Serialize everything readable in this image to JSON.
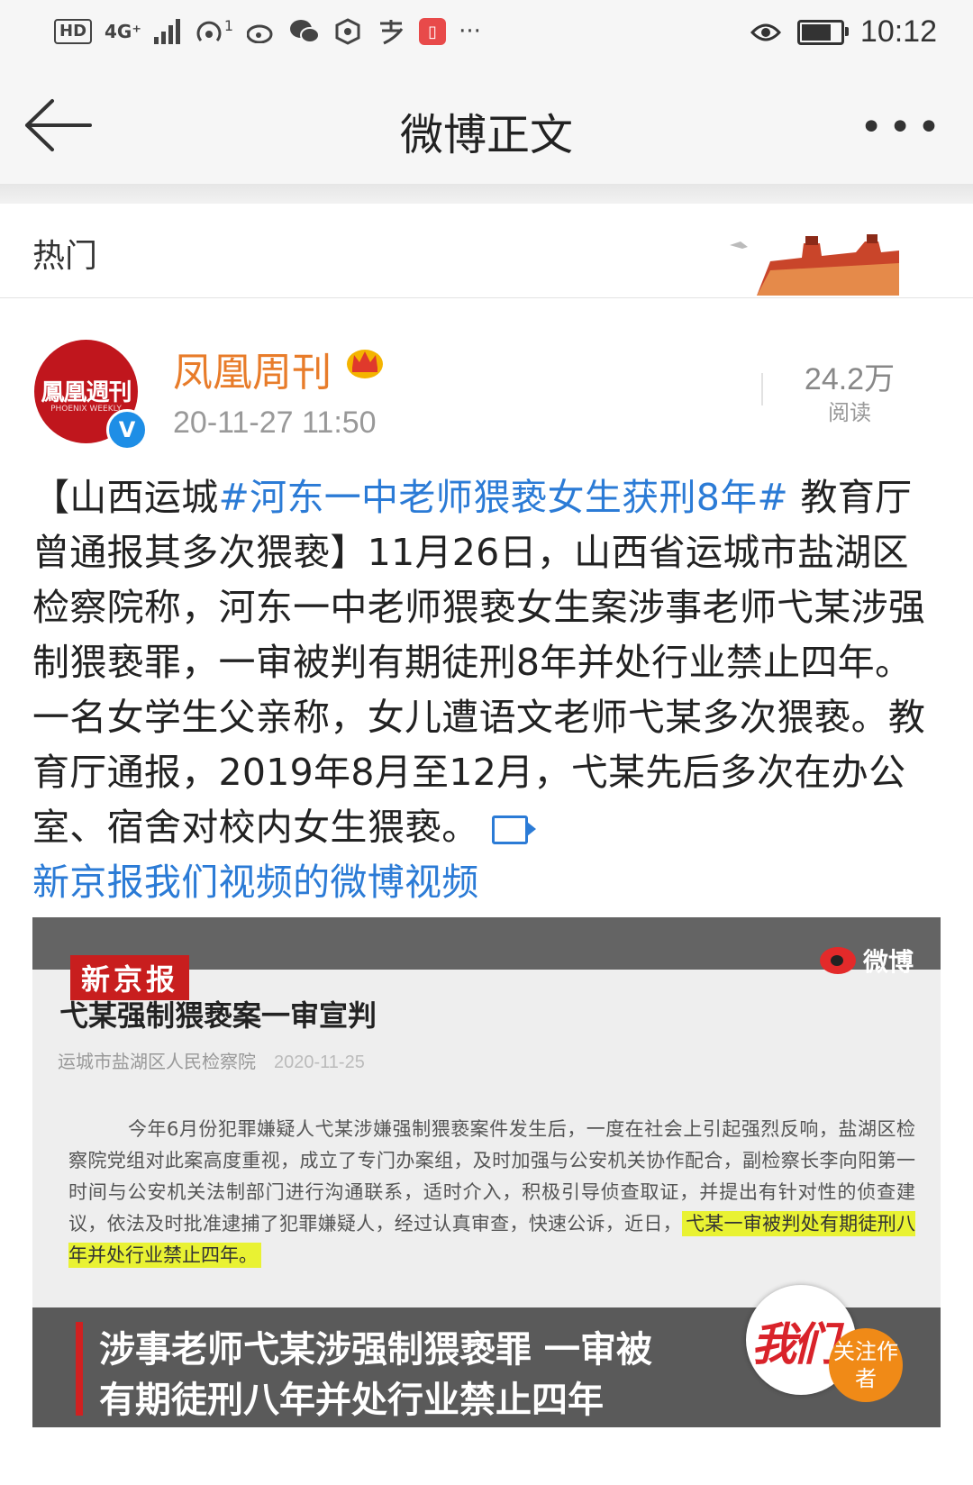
{
  "status_bar": {
    "hd": "HD",
    "network": "4G⁺",
    "hotspot_count": "1",
    "more": "···",
    "time": "10:12",
    "battery_level": 0.8
  },
  "nav": {
    "title": "微博正文"
  },
  "hot_tab": {
    "label": "热门"
  },
  "post": {
    "avatar_text": "鳳凰週刊",
    "avatar_sub": "PHOENIX WEEKLY",
    "verified_mark": "V",
    "author": "凤凰周刊",
    "time": "20-11-27 11:50",
    "reads_count": "24.2万",
    "reads_label": "阅读",
    "text_prefix": "【山西运城",
    "hashtag": "#河东一中老师猥亵女生获刑8年#",
    "text_body": " 教育厅曾通报其多次猥亵】11月26日，山西省运城市盐湖区检察院称，河东一中老师猥亵女生案涉事老师弋某涉强制猥亵罪，一审被判有期徒刑8年并处行业禁止四年。一名女学生父亲称，女儿遭语文老师弋某多次猥亵。教育厅通报，2019年8月至12月，弋某先后多次在办公室、宿舍对校内女生猥亵。",
    "video_link": "新京报我们视频的微博视频"
  },
  "video": {
    "brand": "新京报",
    "watermark": "微博",
    "headline": "弋某强制猥亵案一审宣判",
    "source": "运城市盐湖区人民检察院",
    "date": "2020-11-25",
    "paragraph": "今年6月份犯罪嫌疑人弋某涉嫌强制猥亵案件发生后，一度在社会上引起强烈反响，盐湖区检察院党组对此案高度重视，成立了专门办案组，及时加强与公安机关协作配合，副检察长李向阳第一时间与公安机关法制部门进行沟通联系，适时介入，积极引导侦查取证，并提出有针对性的侦查建议，依法及时批准逮捕了犯罪嫌疑人，经过认真审查，快速公诉，近日，",
    "highlight": "弋某一审被判处有期徒刑八年并处行业禁止四年。",
    "caption_line1": "涉事老师弋某涉强制猥亵罪 一审被",
    "caption_line2": "有期徒刑八年并处行业禁止四年",
    "badge_text": "我们",
    "follow_label": "关注作者"
  },
  "colors": {
    "link_blue": "#2b7bd6",
    "author_orange": "#e87c2a",
    "brand_red": "#c81e1e",
    "follow_orange": "#f08a17"
  }
}
